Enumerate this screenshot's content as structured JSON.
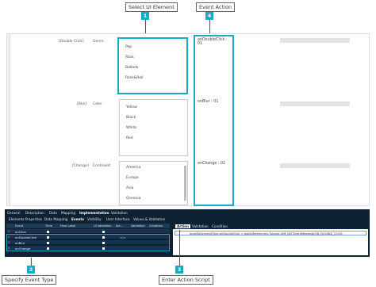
{
  "callouts": [
    {
      "num": "1",
      "label": "Select UI Element"
    },
    {
      "num": "2",
      "label": "Specify Event Type"
    },
    {
      "num": "3",
      "label": "Enter Action Script"
    },
    {
      "num": "4",
      "label": "Event Action"
    }
  ],
  "rows": [
    {
      "event": "[Double Click]",
      "field": "Genre",
      "items": [
        "Pop",
        "Rock",
        "Ballads",
        "Rock&Roll"
      ],
      "action": "onDoubleClick : 01"
    },
    {
      "event": "[Blur]",
      "field": "Color",
      "items": [
        "Yellow",
        "Black",
        "White",
        "Red"
      ],
      "action": "onBlur : 01"
    },
    {
      "event": "[Change]",
      "field": "Continent",
      "items": [
        "America",
        "Europe",
        "Asia",
        "Oceania"
      ],
      "action": "onChange : 01"
    }
  ],
  "bottom": {
    "tabs_row1": [
      "General",
      "Description",
      "Data",
      "Mapping",
      "Implementation",
      "Validation"
    ],
    "active_tab_row1": "Implementation",
    "tabs_row2": [
      "Elements Properties",
      "Data Mapping",
      "Events",
      "Visibility",
      "User Interface",
      "Values & Validation"
    ],
    "active_tab_row2": "Events",
    "grid_headers": [
      "Event",
      "Time",
      "Flow Label",
      "UI Validation",
      "Act...",
      "Validation",
      "Condition"
    ],
    "grid_rows": [
      {
        "num": "1",
        "event": "onClick",
        "action": ""
      },
      {
        "num": "2",
        "event": "onDoubleClick",
        "action": "</>"
      },
      {
        "num": "3",
        "event": "onBlur",
        "action": ""
      },
      {
        "num": "4",
        "event": "onChange",
        "action": ""
      }
    ],
    "right_tabs": [
      "Action",
      "Validation",
      "Condition"
    ],
    "active_right_tab": "Action",
    "line_number": "1",
    "script": "localData.eventType.onDoubleClick = globalDef.enums.Tutorial.UIM_DEF.EventMessage.ON_DOUBLE_CLICK;"
  }
}
